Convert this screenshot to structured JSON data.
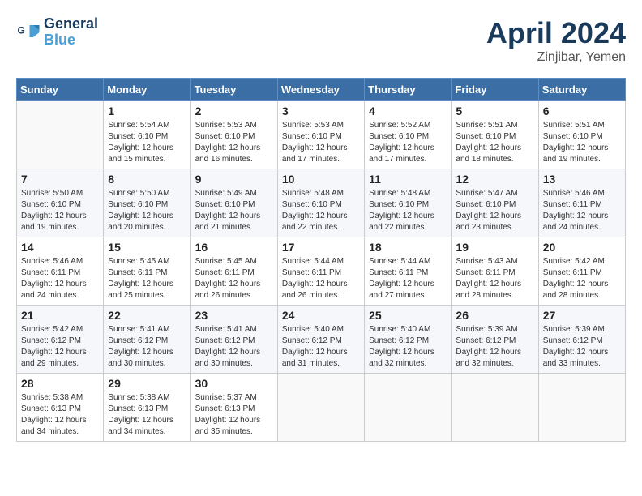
{
  "header": {
    "logo_line1": "General",
    "logo_line2": "Blue",
    "month": "April 2024",
    "location": "Zinjibar, Yemen"
  },
  "columns": [
    "Sunday",
    "Monday",
    "Tuesday",
    "Wednesday",
    "Thursday",
    "Friday",
    "Saturday"
  ],
  "weeks": [
    [
      {
        "day": "",
        "info": ""
      },
      {
        "day": "1",
        "info": "Sunrise: 5:54 AM\nSunset: 6:10 PM\nDaylight: 12 hours\nand 15 minutes."
      },
      {
        "day": "2",
        "info": "Sunrise: 5:53 AM\nSunset: 6:10 PM\nDaylight: 12 hours\nand 16 minutes."
      },
      {
        "day": "3",
        "info": "Sunrise: 5:53 AM\nSunset: 6:10 PM\nDaylight: 12 hours\nand 17 minutes."
      },
      {
        "day": "4",
        "info": "Sunrise: 5:52 AM\nSunset: 6:10 PM\nDaylight: 12 hours\nand 17 minutes."
      },
      {
        "day": "5",
        "info": "Sunrise: 5:51 AM\nSunset: 6:10 PM\nDaylight: 12 hours\nand 18 minutes."
      },
      {
        "day": "6",
        "info": "Sunrise: 5:51 AM\nSunset: 6:10 PM\nDaylight: 12 hours\nand 19 minutes."
      }
    ],
    [
      {
        "day": "7",
        "info": "Sunrise: 5:50 AM\nSunset: 6:10 PM\nDaylight: 12 hours\nand 19 minutes."
      },
      {
        "day": "8",
        "info": "Sunrise: 5:50 AM\nSunset: 6:10 PM\nDaylight: 12 hours\nand 20 minutes."
      },
      {
        "day": "9",
        "info": "Sunrise: 5:49 AM\nSunset: 6:10 PM\nDaylight: 12 hours\nand 21 minutes."
      },
      {
        "day": "10",
        "info": "Sunrise: 5:48 AM\nSunset: 6:10 PM\nDaylight: 12 hours\nand 22 minutes."
      },
      {
        "day": "11",
        "info": "Sunrise: 5:48 AM\nSunset: 6:10 PM\nDaylight: 12 hours\nand 22 minutes."
      },
      {
        "day": "12",
        "info": "Sunrise: 5:47 AM\nSunset: 6:10 PM\nDaylight: 12 hours\nand 23 minutes."
      },
      {
        "day": "13",
        "info": "Sunrise: 5:46 AM\nSunset: 6:11 PM\nDaylight: 12 hours\nand 24 minutes."
      }
    ],
    [
      {
        "day": "14",
        "info": "Sunrise: 5:46 AM\nSunset: 6:11 PM\nDaylight: 12 hours\nand 24 minutes."
      },
      {
        "day": "15",
        "info": "Sunrise: 5:45 AM\nSunset: 6:11 PM\nDaylight: 12 hours\nand 25 minutes."
      },
      {
        "day": "16",
        "info": "Sunrise: 5:45 AM\nSunset: 6:11 PM\nDaylight: 12 hours\nand 26 minutes."
      },
      {
        "day": "17",
        "info": "Sunrise: 5:44 AM\nSunset: 6:11 PM\nDaylight: 12 hours\nand 26 minutes."
      },
      {
        "day": "18",
        "info": "Sunrise: 5:44 AM\nSunset: 6:11 PM\nDaylight: 12 hours\nand 27 minutes."
      },
      {
        "day": "19",
        "info": "Sunrise: 5:43 AM\nSunset: 6:11 PM\nDaylight: 12 hours\nand 28 minutes."
      },
      {
        "day": "20",
        "info": "Sunrise: 5:42 AM\nSunset: 6:11 PM\nDaylight: 12 hours\nand 28 minutes."
      }
    ],
    [
      {
        "day": "21",
        "info": "Sunrise: 5:42 AM\nSunset: 6:12 PM\nDaylight: 12 hours\nand 29 minutes."
      },
      {
        "day": "22",
        "info": "Sunrise: 5:41 AM\nSunset: 6:12 PM\nDaylight: 12 hours\nand 30 minutes."
      },
      {
        "day": "23",
        "info": "Sunrise: 5:41 AM\nSunset: 6:12 PM\nDaylight: 12 hours\nand 30 minutes."
      },
      {
        "day": "24",
        "info": "Sunrise: 5:40 AM\nSunset: 6:12 PM\nDaylight: 12 hours\nand 31 minutes."
      },
      {
        "day": "25",
        "info": "Sunrise: 5:40 AM\nSunset: 6:12 PM\nDaylight: 12 hours\nand 32 minutes."
      },
      {
        "day": "26",
        "info": "Sunrise: 5:39 AM\nSunset: 6:12 PM\nDaylight: 12 hours\nand 32 minutes."
      },
      {
        "day": "27",
        "info": "Sunrise: 5:39 AM\nSunset: 6:12 PM\nDaylight: 12 hours\nand 33 minutes."
      }
    ],
    [
      {
        "day": "28",
        "info": "Sunrise: 5:38 AM\nSunset: 6:13 PM\nDaylight: 12 hours\nand 34 minutes."
      },
      {
        "day": "29",
        "info": "Sunrise: 5:38 AM\nSunset: 6:13 PM\nDaylight: 12 hours\nand 34 minutes."
      },
      {
        "day": "30",
        "info": "Sunrise: 5:37 AM\nSunset: 6:13 PM\nDaylight: 12 hours\nand 35 minutes."
      },
      {
        "day": "",
        "info": ""
      },
      {
        "day": "",
        "info": ""
      },
      {
        "day": "",
        "info": ""
      },
      {
        "day": "",
        "info": ""
      }
    ]
  ]
}
